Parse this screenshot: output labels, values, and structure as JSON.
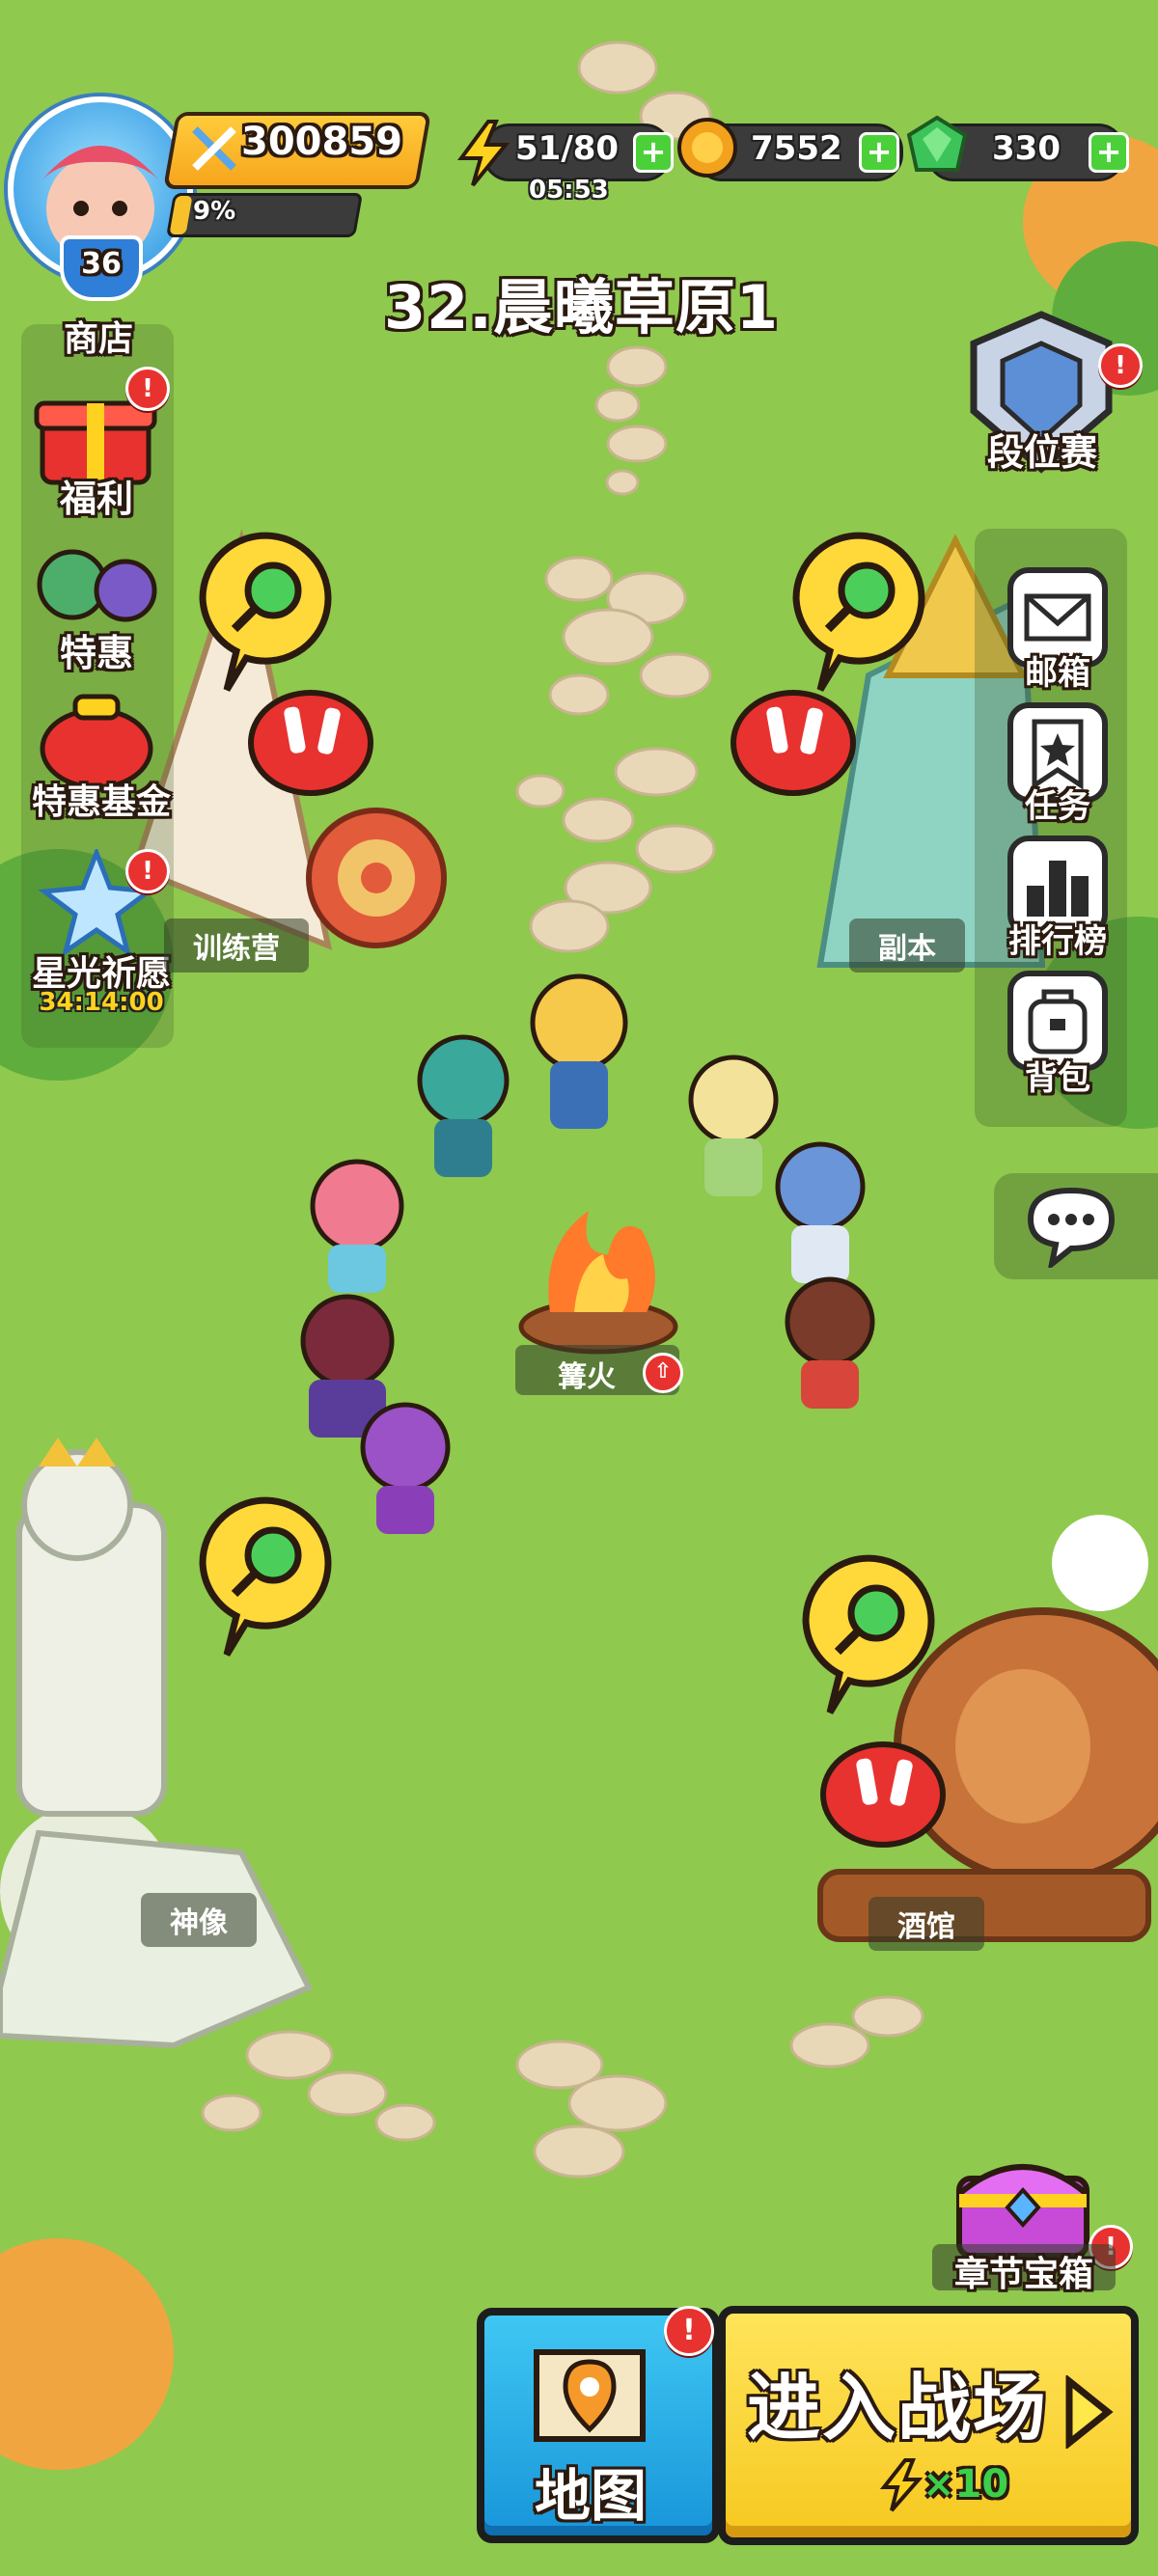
{
  "hud": {
    "power": "300859",
    "exp_percent": "9%",
    "exp_fraction": 0.09,
    "level": "36",
    "energy": "51/80",
    "energy_timer": "05:53",
    "gold": "7552",
    "gems": "330"
  },
  "stage_title": "32.晨曦草原1",
  "left_menu": {
    "shop": "商店",
    "welfare": "福利",
    "special_offer": "特惠",
    "special_fund": "特惠基金",
    "starlight_wish": "星光祈愿",
    "starlight_timer": "34:14:00"
  },
  "right_menu": {
    "ranked": "段位赛",
    "mail": "邮箱",
    "quest": "任务",
    "leaderboard": "排行榜",
    "backpack": "背包"
  },
  "buildings": {
    "training_camp": "训练营",
    "dungeon": "副本",
    "bonfire": "篝火",
    "statue": "神像",
    "tavern": "酒馆",
    "chapter_chest": "章节宝箱"
  },
  "bottom": {
    "map": "地图",
    "enter_battle": "进入战场",
    "energy_cost": "×10"
  },
  "colors": {
    "grass": "#8fc94e",
    "gold_bar": "#f7a51c",
    "gem_green": "#3cc45a",
    "alert_red": "#e8322f",
    "map_blue": "#1895d9",
    "battle_yellow": "#f6c81f"
  }
}
